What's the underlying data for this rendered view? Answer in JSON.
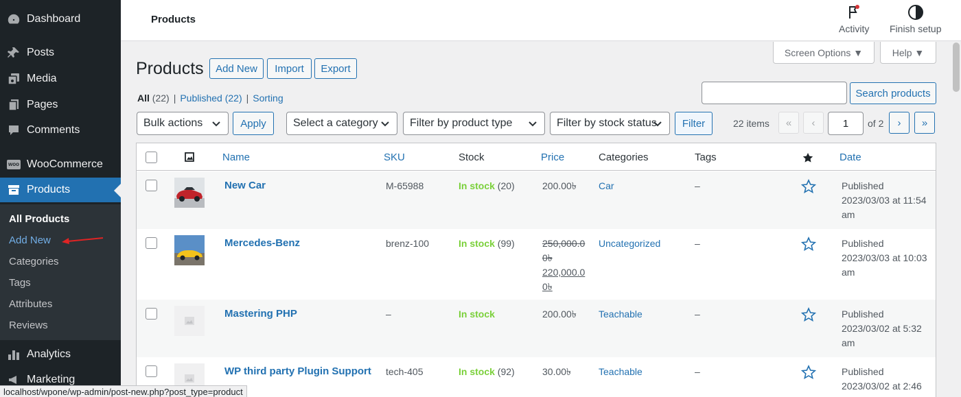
{
  "sidebar": {
    "dashboard": "Dashboard",
    "posts": "Posts",
    "media": "Media",
    "pages": "Pages",
    "comments": "Comments",
    "woocommerce": "WooCommerce",
    "woo_badge": "woo",
    "products": "Products",
    "analytics": "Analytics",
    "marketing": "Marketing",
    "submenu": {
      "all_products": "All Products",
      "add_new": "Add New",
      "categories": "Categories",
      "tags": "Tags",
      "attributes": "Attributes",
      "reviews": "Reviews"
    }
  },
  "topbar": {
    "heading": "Products",
    "activity": "Activity",
    "finish_setup": "Finish setup"
  },
  "screen_options": "Screen Options ▼",
  "help": "Help ▼",
  "page": {
    "title": "Products",
    "add_new": "Add New",
    "import": "Import",
    "export": "Export"
  },
  "status": {
    "all": "All",
    "all_count": "(22)",
    "sep": "|",
    "published": "Published",
    "published_count": "(22)",
    "sorting": "Sorting"
  },
  "search": {
    "button": "Search products",
    "value": ""
  },
  "filters": {
    "bulk_actions": "Bulk actions",
    "apply": "Apply",
    "category": "Select a category",
    "product_type": "Filter by product type",
    "stock_status": "Filter by stock status",
    "filter": "Filter"
  },
  "pagination": {
    "items": "22 items",
    "first": "«",
    "prev": "‹",
    "current": "1",
    "of": "of 2",
    "next": "›",
    "last": "»"
  },
  "columns": {
    "name": "Name",
    "sku": "SKU",
    "stock": "Stock",
    "price": "Price",
    "categories": "Categories",
    "tags": "Tags",
    "date": "Date"
  },
  "rows": [
    {
      "name": "New Car",
      "sku": "M-65988",
      "stock_status": "In stock",
      "stock_qty": "(20)",
      "price": "200.00৳",
      "category": "Car",
      "tags": "–",
      "date_status": "Published",
      "date_line1": "2023/03/03 at 11:54",
      "date_line2": "am"
    },
    {
      "name": "Mercedes-Benz",
      "sku": "brenz-100",
      "stock_status": "In stock",
      "stock_qty": "(99)",
      "price_old_1": "250,000.0",
      "price_old_2": "0৳",
      "price_new_1": "220,000.0",
      "price_new_2": "0৳",
      "category": "Uncategorized",
      "tags": "–",
      "date_status": "Published",
      "date_line1": "2023/03/03 at 10:03",
      "date_line2": "am"
    },
    {
      "name": "Mastering PHP",
      "sku": "–",
      "stock_status": "In stock",
      "stock_qty": "",
      "price": "200.00৳",
      "category": "Teachable",
      "tags": "–",
      "date_status": "Published",
      "date_line1": "2023/03/02 at 5:32",
      "date_line2": "am"
    },
    {
      "name": "WP third party Plugin Support",
      "sku": "tech-405",
      "stock_status": "In stock",
      "stock_qty": "(92)",
      "price": "30.00৳",
      "category": "Teachable",
      "tags": "–",
      "date_status": "Published",
      "date_line1": "2023/03/02 at 2:46",
      "date_line2": ""
    }
  ],
  "status_url": "localhost/wpone/wp-admin/post-new.php?post_type=product"
}
